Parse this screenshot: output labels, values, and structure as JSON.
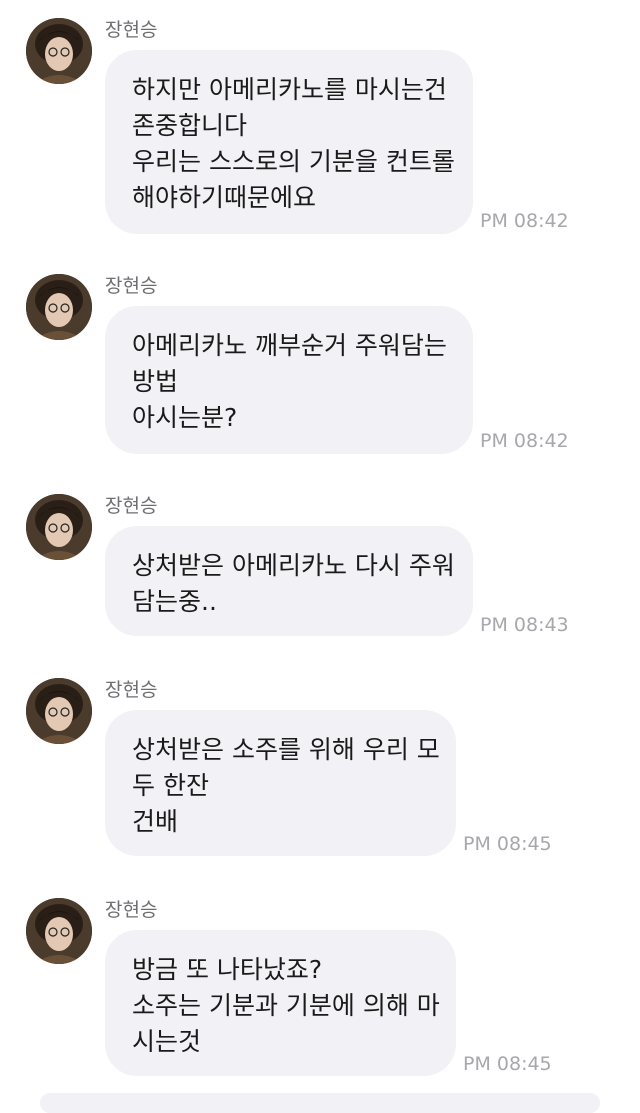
{
  "messages": [
    {
      "sender": "장현승",
      "lines": [
        "하지만 아메리카노를 마시는건",
        "존중합니다",
        "우리는 스스로의 기분을 컨트롤",
        "해야하기때문에요"
      ],
      "time": "PM 08:42"
    },
    {
      "sender": "장현승",
      "lines": [
        "아메리카노 깨부순거 주워담는",
        "방법",
        "아시는분?"
      ],
      "time": "PM 08:42"
    },
    {
      "sender": "장현승",
      "lines": [
        "상처받은 아메리카노 다시 주워",
        "담는중.."
      ],
      "time": "PM 08:43"
    },
    {
      "sender": "장현승",
      "lines": [
        "상처받은 소주를 위해 우리 모",
        "두 한잔",
        "건배"
      ],
      "time": "PM 08:45"
    },
    {
      "sender": "장현승",
      "lines": [
        "방금 또 나타났죠?",
        "소주는 기분과 기분에 의해 마",
        "시는것"
      ],
      "time": "PM 08:45"
    }
  ]
}
